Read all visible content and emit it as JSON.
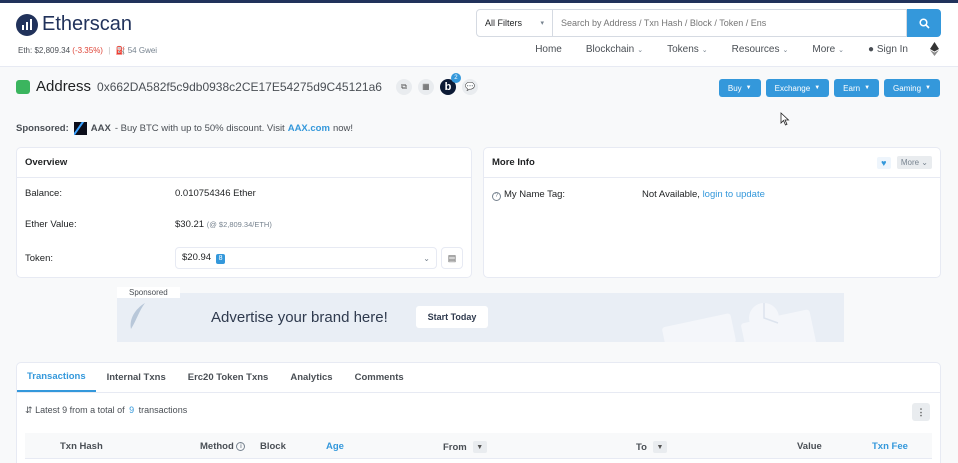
{
  "brand": {
    "name": "Etherscan"
  },
  "ticker": {
    "label": "Eth:",
    "price": "$2,809.34",
    "change": "(-3.35%)",
    "separator": "|",
    "gas": "54 Gwei"
  },
  "search": {
    "filter": "All Filters",
    "placeholder": "Search by Address / Txn Hash / Block / Token / Ens"
  },
  "nav": {
    "home": "Home",
    "blockchain": "Blockchain",
    "tokens": "Tokens",
    "resources": "Resources",
    "more": "More",
    "signin": "Sign In"
  },
  "address": {
    "title": "Address",
    "hash": "0x662DA582f5c9db0938c2CE17E54275d9C45121a6",
    "badge_count": "2"
  },
  "actions": {
    "buy": "Buy",
    "exchange": "Exchange",
    "earn": "Earn",
    "gaming": "Gaming"
  },
  "sponsored": {
    "label": "Sponsored:",
    "name": "AAX",
    "text": "- Buy BTC with up to 50% discount. Visit",
    "link": "AAX.com",
    "suffix": "now!"
  },
  "overview": {
    "title": "Overview",
    "balance_label": "Balance:",
    "balance": "0.010754346 Ether",
    "value_label": "Ether Value:",
    "value": "$30.21",
    "value_rate": "(@ $2,809.34/ETH)",
    "token_label": "Token:",
    "token_value": "$20.94",
    "token_count": "8"
  },
  "moreinfo": {
    "title": "More Info",
    "more": "More",
    "tag_label": "My Name Tag:",
    "tag_value": "Not Available,",
    "tag_link": "login to update"
  },
  "banner": {
    "tag": "Sponsored",
    "text": "Advertise your brand here!",
    "cta": "Start Today"
  },
  "tabs": [
    "Transactions",
    "Internal Txns",
    "Erc20 Token Txns",
    "Analytics",
    "Comments"
  ],
  "txsummary": {
    "prefix": "Latest 9 from a total of",
    "count": "9",
    "suffix": "transactions"
  },
  "columns": {
    "hash": "Txn Hash",
    "method": "Method",
    "block": "Block",
    "age": "Age",
    "from": "From",
    "to": "To",
    "value": "Value",
    "fee": "Txn Fee"
  },
  "colors": {
    "primary": "#3498db",
    "brand": "#21325b",
    "negative": "#de4437"
  }
}
